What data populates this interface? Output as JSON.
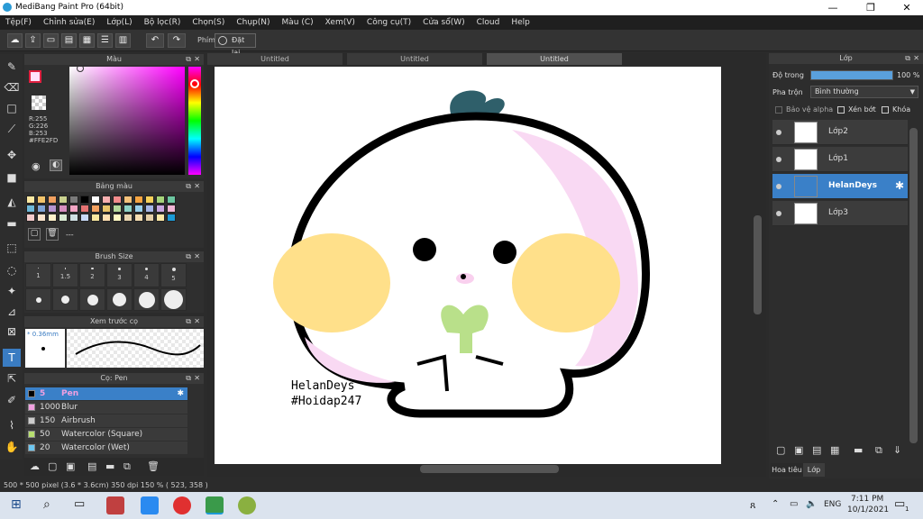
{
  "window": {
    "title": "MediBang Paint Pro (64bit)",
    "minimize": "—",
    "maximize": "❐",
    "close": "✕"
  },
  "menu": [
    "Tệp(F)",
    "Chỉnh sửa(E)",
    "Lớp(L)",
    "Bộ lọc(R)",
    "Chọn(S)",
    "Chụp(N)",
    "Màu (C)",
    "Xem(V)",
    "Công cụ(T)",
    "Cửa sổ(W)",
    "Cloud",
    "Help"
  ],
  "toolbar": {
    "undo": "↶",
    "redo": "↷",
    "phim_label": "Phím",
    "reset_label": "Đặt lại"
  },
  "color_panel": {
    "title": "Màu",
    "r": "R:255",
    "g": "G:226",
    "b": "B:253",
    "hex": "#FFE2FD",
    "accent": "#FFE2FD"
  },
  "palette_panel": {
    "title": "Bảng màu",
    "text": "---",
    "swatches": [
      "#fde9a3",
      "#f3c46b",
      "#f0a060",
      "#c9d18e",
      "#7a7a7a",
      "#000000",
      "#ffffff",
      "#f7b0b0",
      "#f28c8c",
      "#f5c27b",
      "#f7a542",
      "#f6d05a",
      "#a6d47a",
      "#6cc6a0",
      "#6fb9d9",
      "#7fa4d6",
      "#b594d0",
      "#d68fc0",
      "#f2a5c4",
      "#e57373",
      "#f4a261",
      "#e9c46a",
      "#b5d99c",
      "#8fd3c6",
      "#9ad0ec",
      "#a7b8e8",
      "#c9a7e0",
      "#f1b5d6",
      "#f4cccc",
      "#fce5cd",
      "#fff2cc",
      "#d9ead3",
      "#d0e0e3",
      "#c9daf8",
      "#f9e79f",
      "#ffe0b2",
      "#fff9c4",
      "#e8d5b0",
      "#f5deb3",
      "#e6d0a8",
      "#ffeaa7",
      "#1c9ad6"
    ]
  },
  "brush_size_panel": {
    "title": "Brush Size",
    "sizes": [
      "1",
      "1.5",
      "2",
      "3",
      "4",
      "5"
    ]
  },
  "preview_panel": {
    "title": "Xem trước cọ",
    "size": "* 0.36mm"
  },
  "brush_panel": {
    "title": "Cọ: Pen",
    "items": [
      {
        "size": "5",
        "name": "Pen",
        "color": "#000000",
        "selected": true
      },
      {
        "size": "1000",
        "name": "Blur",
        "color": "#f0a0e0"
      },
      {
        "size": "150",
        "name": "Airbrush",
        "color": "#cccccc"
      },
      {
        "size": "50",
        "name": "Watercolor (Square)",
        "color": "#b8e070"
      },
      {
        "size": "20",
        "name": "Watercolor (Wet)",
        "color": "#6cc6f0"
      }
    ]
  },
  "canvas_tabs": [
    "Untitled",
    "Untitled",
    "Untitled"
  ],
  "canvas": {
    "watermark_line1": "HelanDeys",
    "watermark_line2": "#Hoidap247"
  },
  "layer_panel": {
    "title": "Lớp",
    "opacity_label": "Độ trong",
    "opacity_value": "100 %",
    "opacity": 1.0,
    "blend_label": "Pha trộn",
    "blend_value": "Bình thường",
    "alpha_protect": "Bảo vệ alpha",
    "clipping": "Xén bớt",
    "lock": "Khóa",
    "layers": [
      {
        "name": "Lớp2",
        "selected": false
      },
      {
        "name": "Lớp1",
        "selected": false
      },
      {
        "name": "HelanDeys",
        "selected": true
      },
      {
        "name": "Lớp3",
        "selected": false
      }
    ],
    "tab1": "Hoa tiêu",
    "tab2": "Lớp"
  },
  "status": {
    "text": "500 * 500 pixel   (3.6 * 3.6cm)   350 dpi   150 %   ( 523, 358 )"
  },
  "taskbar": {
    "lang": "ENG",
    "time": "7:11 PM",
    "date": "10/1/2021",
    "notif_count": "1"
  }
}
